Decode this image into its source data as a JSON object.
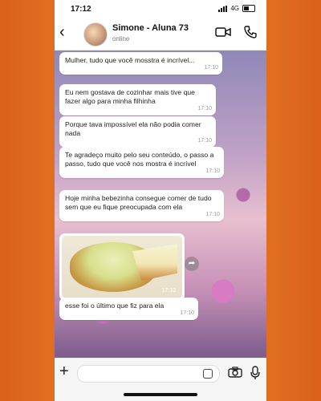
{
  "status_bar": {
    "time": "17:12",
    "network": "4G"
  },
  "header": {
    "contact_name": "Simone - Aluna 73",
    "contact_status": "online"
  },
  "messages": [
    {
      "text": "Mulher, tudo que você mosstra é incrível...",
      "time": "17:10"
    },
    {
      "text": "Eu nem gostava de cozinhar mais tive que fazer algo para minha filhinha",
      "time": "17:10"
    },
    {
      "text": "Porque tava impossível ela não podia comer nada",
      "time": "17:10"
    },
    {
      "text": "Te agradeço muito pelo seu conteúdo, o passo a passo, tudo que você nos mostra é incrível",
      "time": "17:10"
    },
    {
      "text": "Hoje minha bebezinha consegue comer de tudo sem que eu fique preocupada com ela",
      "time": "17:10"
    },
    {
      "type": "image",
      "time": "17:10"
    },
    {
      "text": "esse foi o último que fiz para ela",
      "time": "17:10"
    }
  ],
  "composer": {
    "placeholder": ""
  },
  "colors": {
    "frame": "#f08a2c",
    "bubble": "#ffffff",
    "accent": "#111111"
  },
  "icons": [
    "back-arrow-icon",
    "video-call-icon",
    "phone-icon",
    "plus-icon",
    "sticker-icon",
    "camera-icon",
    "microphone-icon",
    "forward-icon"
  ]
}
